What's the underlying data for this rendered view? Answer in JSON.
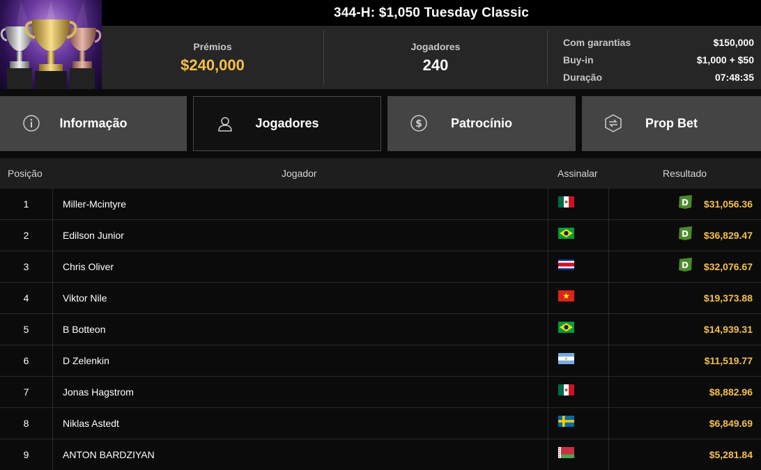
{
  "header": {
    "title": "344-H: $1,050 Tuesday Classic"
  },
  "stats": {
    "prizes_label": "Prémios",
    "prizes_value": "$240,000",
    "players_label": "Jogadores",
    "players_value": "240",
    "info": [
      {
        "label": "Com garantias",
        "value": "$150,000"
      },
      {
        "label": "Buy-in",
        "value": "$1,000 + $50"
      },
      {
        "label": "Duração",
        "value": "07:48:35"
      }
    ]
  },
  "tabs": [
    {
      "label": "Informação",
      "icon": "info-icon",
      "active": false
    },
    {
      "label": "Jogadores",
      "icon": "user-icon",
      "active": true
    },
    {
      "label": "Patrocínio",
      "icon": "dollar-coin-icon",
      "active": false
    },
    {
      "label": "Prop Bet",
      "icon": "prop-bet-icon",
      "active": false
    }
  ],
  "table": {
    "headers": {
      "position": "Posição",
      "player": "Jogador",
      "flag": "Assinalar",
      "result": "Resultado"
    },
    "rows": [
      {
        "position": "1",
        "player": "Miller-Mcintyre",
        "flag": "mexico",
        "result": "$31,056.36",
        "badge": true
      },
      {
        "position": "2",
        "player": "Edilson Junior",
        "flag": "brazil",
        "result": "$36,829.47",
        "badge": true
      },
      {
        "position": "3",
        "player": "Chris Oliver",
        "flag": "costa-rica",
        "result": "$32,076.67",
        "badge": true
      },
      {
        "position": "4",
        "player": "Viktor Nile",
        "flag": "vietnam",
        "result": "$19,373.88",
        "badge": false
      },
      {
        "position": "5",
        "player": "B Botteon",
        "flag": "brazil",
        "result": "$14,939.31",
        "badge": false
      },
      {
        "position": "6",
        "player": "D Zelenkin",
        "flag": "argentina",
        "result": "$11,519.77",
        "badge": false
      },
      {
        "position": "7",
        "player": "Jonas Hagstrom",
        "flag": "mexico",
        "result": "$8,882.96",
        "badge": false
      },
      {
        "position": "8",
        "player": "Niklas Astedt",
        "flag": "sweden",
        "result": "$6,849.69",
        "badge": false
      },
      {
        "position": "9",
        "player": "ANTON BARDZIYAN",
        "flag": "belarus",
        "result": "$5,281.84",
        "badge": false
      }
    ]
  },
  "colors": {
    "gold": "#f5c04a",
    "badge_green": "#4a8a2a"
  }
}
